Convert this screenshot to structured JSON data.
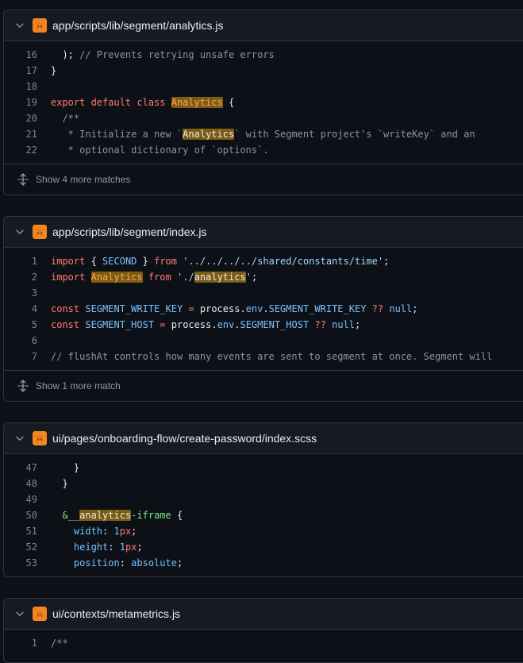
{
  "results": [
    {
      "path": "app/scripts/lib/segment/analytics.js",
      "lines": [
        {
          "n": "16",
          "segs": [
            {
              "t": "  ); ",
              "c": ""
            },
            {
              "t": "// Prevents retrying unsafe errors",
              "c": "c"
            }
          ]
        },
        {
          "n": "17",
          "segs": [
            {
              "t": "}",
              "c": ""
            }
          ]
        },
        {
          "n": "18",
          "segs": [
            {
              "t": "",
              "c": ""
            }
          ]
        },
        {
          "n": "19",
          "segs": [
            {
              "t": "export default class ",
              "c": "k"
            },
            {
              "t": "Analytics",
              "c": "hl-o"
            },
            {
              "t": " {",
              "c": ""
            }
          ]
        },
        {
          "n": "20",
          "segs": [
            {
              "t": "  /**",
              "c": "c"
            }
          ]
        },
        {
          "n": "21",
          "segs": [
            {
              "t": "   * Initialize a new `",
              "c": "c"
            },
            {
              "t": "Analytics",
              "c": "hl"
            },
            {
              "t": "` with Segment project's `writeKey` and an",
              "c": "c"
            }
          ]
        },
        {
          "n": "22",
          "segs": [
            {
              "t": "   * optional dictionary of `options`.",
              "c": "c"
            }
          ]
        }
      ],
      "more": "Show 4 more matches"
    },
    {
      "path": "app/scripts/lib/segment/index.js",
      "lines": [
        {
          "n": "1",
          "segs": [
            {
              "t": "import",
              "c": "k"
            },
            {
              "t": " { ",
              "c": ""
            },
            {
              "t": "SECOND",
              "c": "n"
            },
            {
              "t": " } ",
              "c": ""
            },
            {
              "t": "from",
              "c": "k"
            },
            {
              "t": " ",
              "c": ""
            },
            {
              "t": "'../../../../shared/constants/time'",
              "c": "s"
            },
            {
              "t": ";",
              "c": ""
            }
          ]
        },
        {
          "n": "2",
          "segs": [
            {
              "t": "import",
              "c": "k"
            },
            {
              "t": " ",
              "c": ""
            },
            {
              "t": "Analytics",
              "c": "hl-o"
            },
            {
              "t": " ",
              "c": ""
            },
            {
              "t": "from",
              "c": "k"
            },
            {
              "t": " ",
              "c": ""
            },
            {
              "t": "'./",
              "c": "s"
            },
            {
              "t": "analytics",
              "c": "hl"
            },
            {
              "t": "'",
              "c": "s"
            },
            {
              "t": ";",
              "c": ""
            }
          ]
        },
        {
          "n": "3",
          "segs": [
            {
              "t": "",
              "c": ""
            }
          ]
        },
        {
          "n": "4",
          "segs": [
            {
              "t": "const",
              "c": "k"
            },
            {
              "t": " ",
              "c": ""
            },
            {
              "t": "SEGMENT_WRITE_KEY",
              "c": "n"
            },
            {
              "t": " ",
              "c": ""
            },
            {
              "t": "=",
              "c": "k"
            },
            {
              "t": " process.",
              "c": ""
            },
            {
              "t": "env",
              "c": "n"
            },
            {
              "t": ".",
              "c": ""
            },
            {
              "t": "SEGMENT_WRITE_KEY",
              "c": "n"
            },
            {
              "t": " ",
              "c": ""
            },
            {
              "t": "??",
              "c": "k"
            },
            {
              "t": " ",
              "c": ""
            },
            {
              "t": "null",
              "c": "n"
            },
            {
              "t": ";",
              "c": ""
            }
          ]
        },
        {
          "n": "5",
          "segs": [
            {
              "t": "const",
              "c": "k"
            },
            {
              "t": " ",
              "c": ""
            },
            {
              "t": "SEGMENT_HOST",
              "c": "n"
            },
            {
              "t": " ",
              "c": ""
            },
            {
              "t": "=",
              "c": "k"
            },
            {
              "t": " process.",
              "c": ""
            },
            {
              "t": "env",
              "c": "n"
            },
            {
              "t": ".",
              "c": ""
            },
            {
              "t": "SEGMENT_HOST",
              "c": "n"
            },
            {
              "t": " ",
              "c": ""
            },
            {
              "t": "??",
              "c": "k"
            },
            {
              "t": " ",
              "c": ""
            },
            {
              "t": "null",
              "c": "n"
            },
            {
              "t": ";",
              "c": ""
            }
          ]
        },
        {
          "n": "6",
          "segs": [
            {
              "t": "",
              "c": ""
            }
          ]
        },
        {
          "n": "7",
          "segs": [
            {
              "t": "// flushAt controls how many events are sent to segment at once. Segment will",
              "c": "c"
            }
          ]
        }
      ],
      "more": "Show 1 more match"
    },
    {
      "path": "ui/pages/onboarding-flow/create-password/index.scss",
      "lines": [
        {
          "n": "47",
          "segs": [
            {
              "t": "    }",
              "c": ""
            }
          ]
        },
        {
          "n": "48",
          "segs": [
            {
              "t": "  }",
              "c": ""
            }
          ]
        },
        {
          "n": "49",
          "segs": [
            {
              "t": "",
              "c": ""
            }
          ]
        },
        {
          "n": "50",
          "segs": [
            {
              "t": "  ",
              "c": ""
            },
            {
              "t": "&",
              "c": "t"
            },
            {
              "t": "__",
              "c": "t"
            },
            {
              "t": "analytics",
              "c": "hl"
            },
            {
              "t": "-iframe",
              "c": "t"
            },
            {
              "t": " {",
              "c": ""
            }
          ]
        },
        {
          "n": "51",
          "segs": [
            {
              "t": "    ",
              "c": ""
            },
            {
              "t": "width",
              "c": "n"
            },
            {
              "t": ": ",
              "c": ""
            },
            {
              "t": "1",
              "c": "n"
            },
            {
              "t": "px",
              "c": "k"
            },
            {
              "t": ";",
              "c": ""
            }
          ]
        },
        {
          "n": "52",
          "segs": [
            {
              "t": "    ",
              "c": ""
            },
            {
              "t": "height",
              "c": "n"
            },
            {
              "t": ": ",
              "c": ""
            },
            {
              "t": "1",
              "c": "n"
            },
            {
              "t": "px",
              "c": "k"
            },
            {
              "t": ";",
              "c": ""
            }
          ]
        },
        {
          "n": "53",
          "segs": [
            {
              "t": "    ",
              "c": ""
            },
            {
              "t": "position",
              "c": "n"
            },
            {
              "t": ": ",
              "c": ""
            },
            {
              "t": "absolute",
              "c": "n"
            },
            {
              "t": ";",
              "c": ""
            }
          ]
        }
      ],
      "more": ""
    },
    {
      "path": "ui/contexts/metametrics.js",
      "lines": [
        {
          "n": "1",
          "segs": [
            {
              "t": "/**",
              "c": "c"
            }
          ]
        }
      ],
      "more": ""
    }
  ]
}
